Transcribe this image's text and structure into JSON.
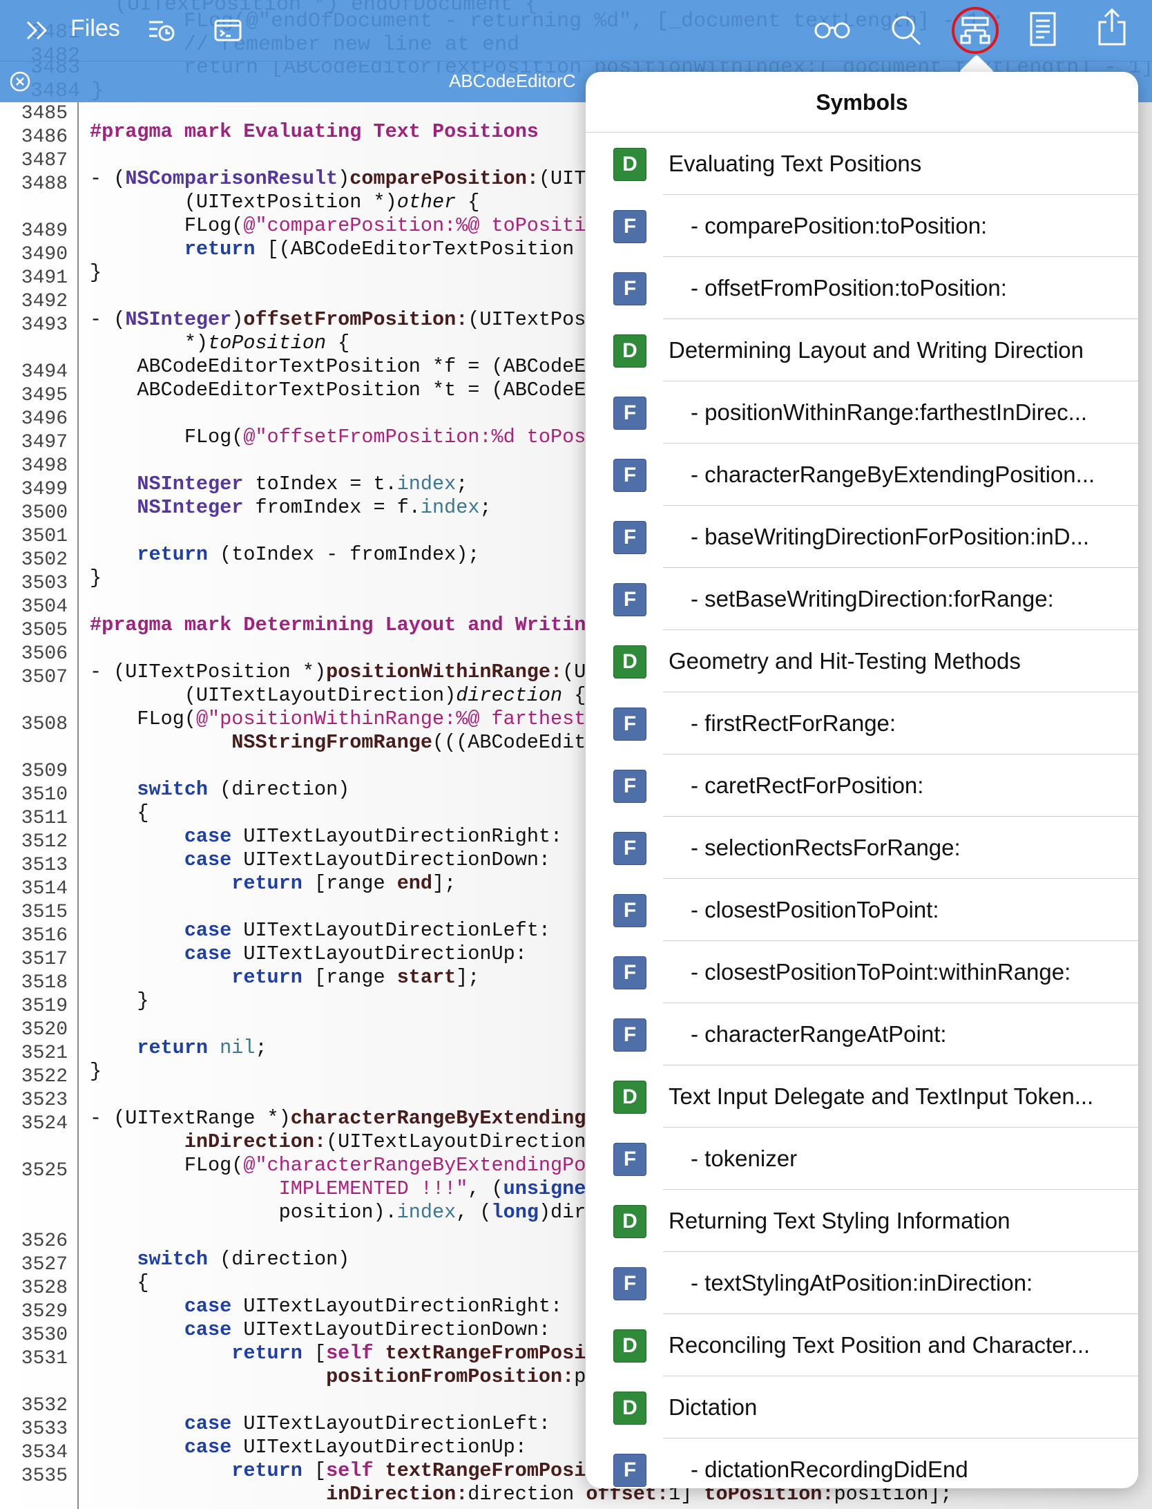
{
  "toolbar": {
    "files_label": "Files",
    "tab_title": "ABCodeEditorC",
    "icons": [
      "chevrons-right-icon",
      "outline-history-icon",
      "terminal-icon",
      "reading-glasses-icon",
      "search-icon",
      "symbols-icon",
      "document-icon",
      "share-icon",
      "close-tab-icon"
    ],
    "ghost_lines": [
      "(UITextPosition *) endOfDocument {",
      "FLog(@\"endOfDocument - returning %d\", [_document textLength] - 1);",
      "// remember new line at end",
      "return [ABCodeEditorTextPosition positionWithIndex:[_document textLength] - 1];",
      "}"
    ],
    "ghost_numbers": [
      "3481",
      "3482",
      "3483",
      "3484"
    ],
    "highlight_color": "#e0141c"
  },
  "editor": {
    "gutter_numbers": [
      "3485",
      "3486",
      "3487",
      "3488",
      "",
      "3489",
      "3490",
      "3491",
      "3492",
      "3493",
      "",
      "3494",
      "3495",
      "3496",
      "3497",
      "3498",
      "3499",
      "3500",
      "3501",
      "3502",
      "3503",
      "3504",
      "3505",
      "3506",
      "3507",
      "",
      "3508",
      "",
      "3509",
      "3510",
      "3511",
      "3512",
      "3513",
      "3514",
      "3515",
      "3516",
      "3517",
      "3518",
      "3519",
      "3520",
      "3521",
      "3522",
      "3523",
      "3524",
      "",
      "3525",
      "",
      "",
      "3526",
      "3527",
      "3528",
      "3529",
      "3530",
      "3531",
      "",
      "3532",
      "3533",
      "3534",
      "3535"
    ]
  },
  "code_lines": {
    "l1": "#pragma mark Evaluating Text Positions",
    "l3a": "- (",
    "l3b": "NSComparisonResult",
    "l3c": ")",
    "l3d": "comparePosition:",
    "l3e": "(UITe",
    "l4a": "        (UITextPosition *)",
    "l4b": "other",
    "l4c": " {",
    "l5a": "        FLog(",
    "l5b": "@\"comparePosition:%@ toPositic",
    "l6a": "        ",
    "l6b": "return",
    "l6c": " [(ABCodeEditorTextPosition *",
    "l7": "}",
    "l9a": "- (",
    "l9b": "NSInteger",
    "l9c": ")",
    "l9d": "offsetFromPosition:",
    "l9e": "(UITextPosi",
    "l10a": "        *)",
    "l10b": "toPosition",
    "l10c": " {",
    "l11": "    ABCodeEditorTextPosition *f = (ABCodeEd",
    "l12": "    ABCodeEditorTextPosition *t = (ABCodeEd",
    "l14a": "        FLog(",
    "l14b": "@\"offsetFromPosition:%d toPosi",
    "l16a": "    ",
    "l16b": "NSInteger",
    "l16c": " toIndex = t.",
    "l16d": "index",
    "l16e": ";",
    "l17a": "    ",
    "l17b": "NSInteger",
    "l17c": " fromIndex = f.",
    "l17d": "index",
    "l17e": ";",
    "l19a": "    ",
    "l19b": "return",
    "l19c": " (toIndex - fromIndex);",
    "l20": "}",
    "l22": "#pragma mark Determining Layout and Writing",
    "l24a": "- (UITextPosition *)",
    "l24b": "positionWithinRange:",
    "l24c": "(UI",
    "l25a": "        (UITextLayoutDirection)",
    "l25b": "direction",
    "l25c": " {",
    "l26a": "    FLog(",
    "l26b": "@\"positionWithinRange:%@ farthestI",
    "l27a": "            ",
    "l27b": "NSStringFromRange",
    "l27c": "(((ABCodeEdito",
    "l29a": "    ",
    "l29b": "switch",
    "l29c": " (direction)",
    "l30": "    {",
    "l31a": "        ",
    "l31b": "case",
    "l31c": " UITextLayoutDirectionRight:",
    "l32a": "        ",
    "l32b": "case",
    "l32c": " UITextLayoutDirectionDown:",
    "l33a": "            ",
    "l33b": "return",
    "l33c": " [range ",
    "l33d": "end",
    "l33e": "];",
    "l35a": "        ",
    "l35b": "case",
    "l35c": " UITextLayoutDirectionLeft:",
    "l36a": "        ",
    "l36b": "case",
    "l36c": " UITextLayoutDirectionUp:",
    "l37a": "            ",
    "l37b": "return",
    "l37c": " [range ",
    "l37d": "start",
    "l37e": "];",
    "l38": "    }",
    "l40a": "    ",
    "l40b": "return",
    "l40c": " ",
    "l40d": "nil",
    "l40e": ";",
    "l41": "}",
    "l43a": "- (UITextRange *)",
    "l43b": "characterRangeByExtendingP",
    "l44a": "        ",
    "l44b": "inDirection:",
    "l44c": "(UITextLayoutDirection)",
    "l45a": "        FLog(",
    "l45b": "@\"characterRangeByExtendingPos",
    "l46a": "                ",
    "l46b": "IMPLEMENTED !!!\"",
    "l46c": ", (",
    "l46d": "unsigned",
    "l47a": "                position).",
    "l47b": "index",
    "l47c": ", (",
    "l47d": "long",
    "l47e": ")dire",
    "l49a": "    ",
    "l49b": "switch",
    "l49c": " (direction)",
    "l50": "    {",
    "l51a": "        ",
    "l51b": "case",
    "l51c": " UITextLayoutDirectionRight:",
    "l52a": "        ",
    "l52b": "case",
    "l52c": " UITextLayoutDirectionDown:",
    "l53a": "            ",
    "l53b": "return",
    "l53c": " [",
    "l53d": "self",
    "l53e": " ",
    "l53f": "textRangeFromPosit",
    "l54a": "                    ",
    "l54b": "positionFromPosition:",
    "l54c": "pc",
    "l56a": "        ",
    "l56b": "case",
    "l56c": " UITextLayoutDirectionLeft:",
    "l57a": "        ",
    "l57b": "case",
    "l57c": " UITextLayoutDirectionUp:",
    "l58a": "            ",
    "l58b": "return",
    "l58c": " [",
    "l58d": "self",
    "l58e": " ",
    "l58f": "textRangeFromPosit",
    "l59a": "                    ",
    "l59b": "inDirection:",
    "l59c": "direction ",
    "l59d": "offset:",
    "l59e": "1] ",
    "l59f": "toPosition:",
    "l59g": "position];"
  },
  "symbols_popover": {
    "title": "Symbols",
    "items": [
      {
        "kind": "D",
        "label": "Evaluating Text Positions"
      },
      {
        "kind": "F",
        "label": "- comparePosition:toPosition:"
      },
      {
        "kind": "F",
        "label": "- offsetFromPosition:toPosition:"
      },
      {
        "kind": "D",
        "label": "Determining Layout and Writing Direction"
      },
      {
        "kind": "F",
        "label": "- positionWithinRange:farthestInDirec..."
      },
      {
        "kind": "F",
        "label": "- characterRangeByExtendingPosition..."
      },
      {
        "kind": "F",
        "label": "- baseWritingDirectionForPosition:inD..."
      },
      {
        "kind": "F",
        "label": "- setBaseWritingDirection:forRange:"
      },
      {
        "kind": "D",
        "label": "Geometry and Hit-Testing Methods"
      },
      {
        "kind": "F",
        "label": "- firstRectForRange:"
      },
      {
        "kind": "F",
        "label": "- caretRectForPosition:"
      },
      {
        "kind": "F",
        "label": "- selectionRectsForRange:"
      },
      {
        "kind": "F",
        "label": "- closestPositionToPoint:"
      },
      {
        "kind": "F",
        "label": "- closestPositionToPoint:withinRange:"
      },
      {
        "kind": "F",
        "label": "- characterRangeAtPoint:"
      },
      {
        "kind": "D",
        "label": "Text Input Delegate and TextInput Token..."
      },
      {
        "kind": "F",
        "label": "- tokenizer"
      },
      {
        "kind": "D",
        "label": "Returning Text Styling Information"
      },
      {
        "kind": "F",
        "label": "- textStylingAtPosition:inDirection:"
      },
      {
        "kind": "D",
        "label": "Reconciling Text Position and Character..."
      },
      {
        "kind": "D",
        "label": "Dictation"
      },
      {
        "kind": "F",
        "label": "- dictationRecordingDidEnd"
      }
    ]
  }
}
